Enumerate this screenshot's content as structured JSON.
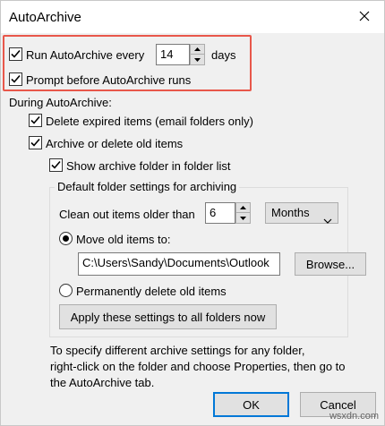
{
  "window": {
    "title": "AutoArchive"
  },
  "icons": {
    "close": "close-icon",
    "check": "checkmark-icon",
    "spin_up": "spin-up-icon",
    "spin_down": "spin-down-icon",
    "dropdown": "chevron-down-icon"
  },
  "colors": {
    "highlight": "#e8574a",
    "default_button_border": "#0078d7"
  },
  "autoarchive": {
    "run_label": "Run AutoArchive every",
    "run_checked": true,
    "run_days_value": "14",
    "days_label": "days",
    "prompt_label": "Prompt before AutoArchive runs",
    "prompt_checked": true
  },
  "during": {
    "heading": "During AutoArchive:",
    "delete_expired_label": "Delete expired items (email folders only)",
    "delete_expired_checked": true,
    "archive_label": "Archive or delete old items",
    "archive_checked": true,
    "show_folder_label": "Show archive folder in folder list",
    "show_folder_checked": true
  },
  "defaults_group": {
    "legend": "Default folder settings for archiving",
    "clean_label": "Clean out items older than",
    "clean_value": "6",
    "period_selected": "Months",
    "move_label": "Move old items to:",
    "move_selected": true,
    "path_value": "C:\\Users\\Sandy\\Documents\\Outlook F",
    "browse_label": "Browse...",
    "delete_label": "Permanently delete old items",
    "delete_selected": false,
    "apply_label": "Apply these settings to all folders now"
  },
  "help": {
    "line1": "To specify different archive settings for any folder,",
    "line2": "right-click on the folder and choose Properties, then go to",
    "line3": "the AutoArchive tab."
  },
  "footer": {
    "ok_label": "OK",
    "cancel_label": "Cancel"
  },
  "watermark": "wsxdn.com"
}
